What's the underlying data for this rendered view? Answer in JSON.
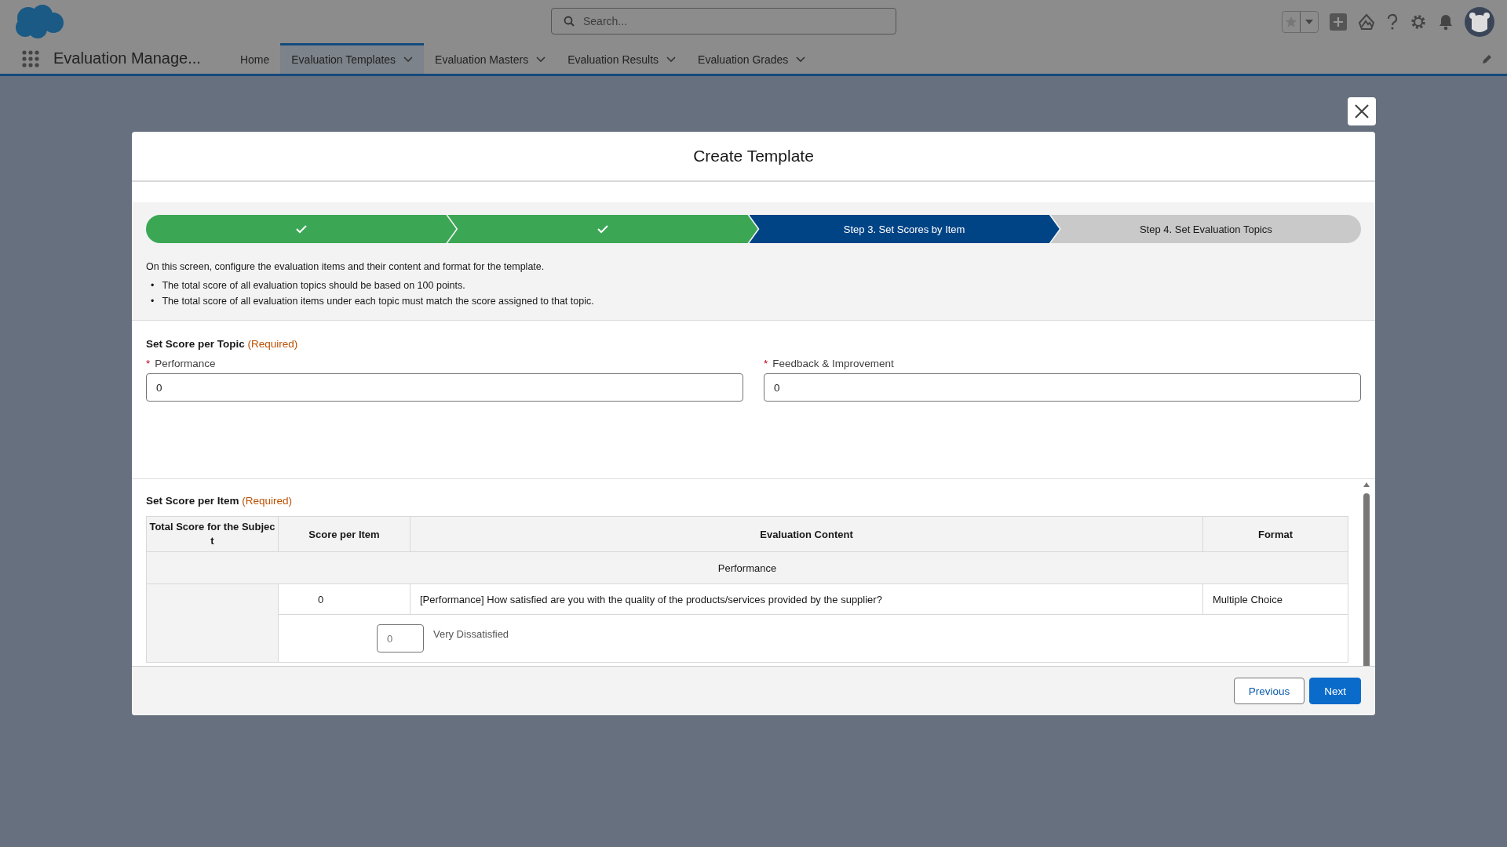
{
  "app": {
    "name": "Evaluation Manage...",
    "search_placeholder": "Search..."
  },
  "nav": [
    {
      "label": "Home",
      "selected": false,
      "dropdown": false
    },
    {
      "label": "Evaluation Templates",
      "selected": true,
      "dropdown": true
    },
    {
      "label": "Evaluation Masters",
      "selected": false,
      "dropdown": true
    },
    {
      "label": "Evaluation Results",
      "selected": false,
      "dropdown": true
    },
    {
      "label": "Evaluation Grades",
      "selected": false,
      "dropdown": true
    }
  ],
  "modal": {
    "title": "Create Template",
    "steps": [
      {
        "completed": true,
        "selected": false
      },
      {
        "completed": true,
        "selected": false
      },
      {
        "label": "Step 3. Set Scores by Item",
        "completed": false,
        "selected": true
      },
      {
        "label": "Step 4. Set Evaluation Topics",
        "completed": false,
        "selected": false
      }
    ],
    "intro": "On this screen, configure the evaluation items and their content and format for the template.",
    "bullets": [
      {
        "marker": "•",
        "text": "The total score of all evaluation topics should be based on 100 points."
      },
      {
        "marker": "•",
        "text": "The total score of all evaluation items under each topic must match the score assigned to that topic."
      }
    ],
    "topic_section": {
      "title": "Set Score per Topic",
      "note": "(Required)",
      "fields": [
        {
          "label": "Performance",
          "required_mark": "*",
          "value": "0"
        },
        {
          "label": "Feedback & Improvement",
          "required_mark": "*",
          "value": "0"
        }
      ]
    },
    "item_section": {
      "title": "Set Score per Item",
      "note": "(Required)",
      "columns": [
        "Total Score for the Subject",
        "Score per Item",
        "Evaluation Content",
        "Format"
      ],
      "group": "Performance",
      "rows": [
        {
          "score": "0",
          "content": "[Performance] How satisfied are you with the quality of the products/services provided by the supplier?",
          "format": "Multiple Choice"
        }
      ],
      "choices": [
        {
          "placeholder": "0",
          "label": "Very Dissatisfied"
        }
      ]
    },
    "buttons": [
      {
        "label": "Previous",
        "kind": "neutral"
      },
      {
        "label": "Next",
        "kind": "brand"
      }
    ]
  }
}
